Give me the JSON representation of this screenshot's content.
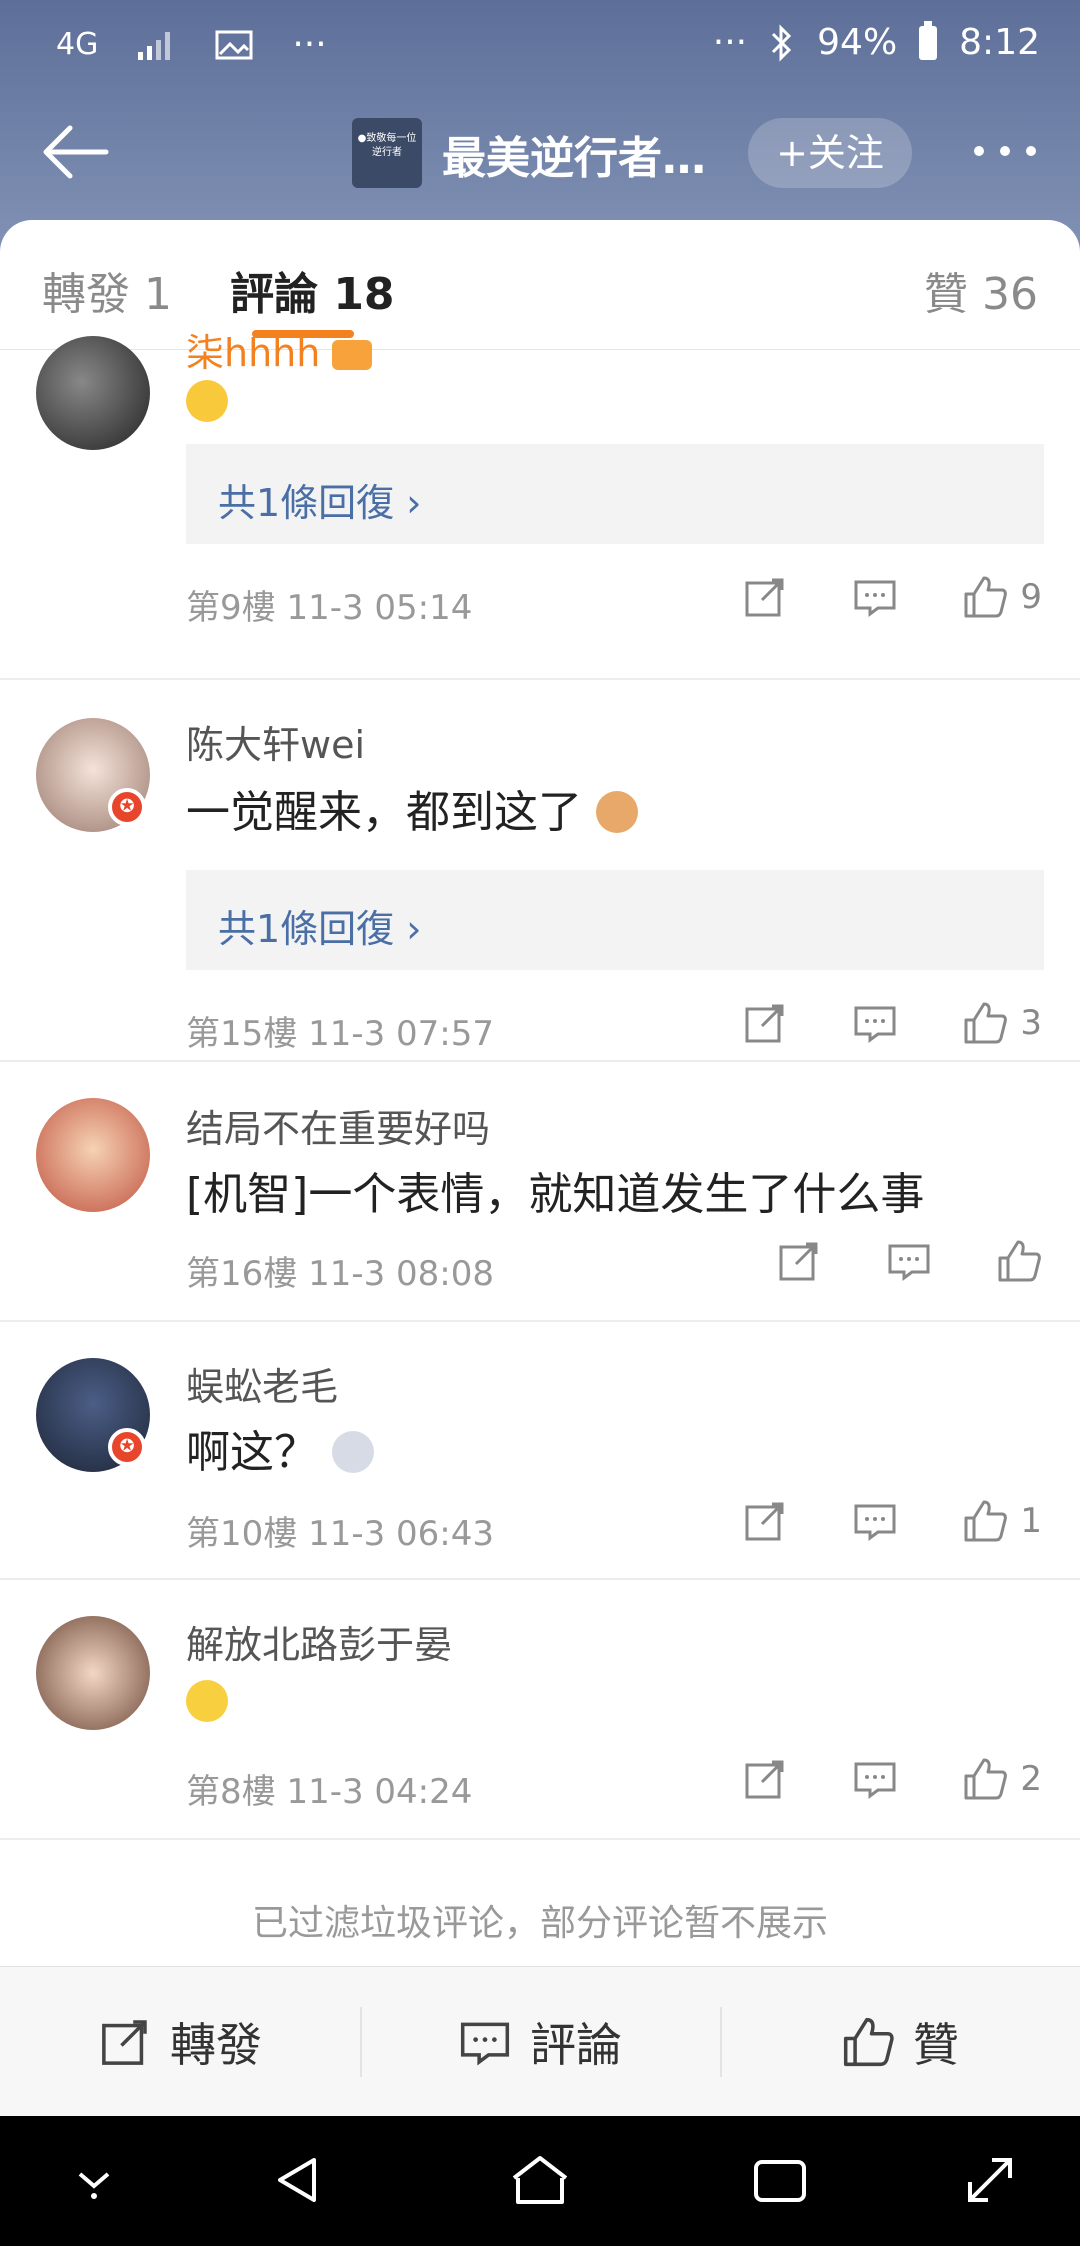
{
  "status": {
    "network": "4G",
    "battery_percent": "94%",
    "time": "8:12",
    "dots": "···"
  },
  "header": {
    "title": "最美逆行者…",
    "follow": "+关注",
    "thumb_text": "●致敬每一位逆行者"
  },
  "tabs": {
    "repost": "轉發 1",
    "comments": "評論 18",
    "likes": "贊 36"
  },
  "comments": [
    {
      "username": "柒hhhh",
      "content": "",
      "reply": "共1條回復 ›",
      "floor": "第9樓 11-3 05:14",
      "likes": "9"
    },
    {
      "username": "陈大轩wei",
      "content": "一觉醒来，都到这了",
      "reply": "共1條回復 ›",
      "floor": "第15樓 11-3 07:57",
      "likes": "3"
    },
    {
      "username": "结局不在重要好吗",
      "content": "[机智]一个表情，就知道发生了什么事",
      "floor": "第16樓 11-3 08:08",
      "likes": ""
    },
    {
      "username": "蜈蚣老毛",
      "content": "啊这？",
      "floor": "第10樓 11-3 06:43",
      "likes": "1"
    },
    {
      "username": "解放北路彭于晏",
      "content": "",
      "floor": "第8樓 11-3 04:24",
      "likes": "2"
    }
  ],
  "filter_note": "已过滤垃圾评论，部分评论暂不展示",
  "toolbar": {
    "repost": "轉發",
    "comment": "評論",
    "like": "贊"
  },
  "colors": {
    "header_top": "#5d6f99",
    "accent": "#f48120",
    "reply_link": "#4a6fa6",
    "vip_name": "#f48120"
  }
}
